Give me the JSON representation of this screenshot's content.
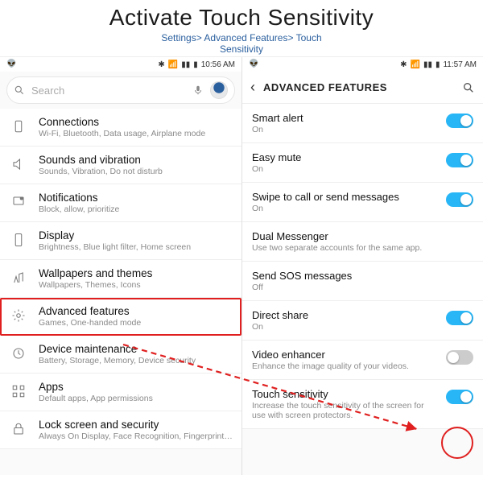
{
  "header": {
    "title": "Activate Touch Sensitivity",
    "breadcrumb1": "Settings> Advanced Features> Touch",
    "breadcrumb2": "Sensitivity"
  },
  "left": {
    "status": {
      "left_icon": "reddit-icon",
      "time": "10:56 AM"
    },
    "search": {
      "placeholder": "Search"
    },
    "items": [
      {
        "icon": "connections-icon",
        "label": "Connections",
        "sub": "Wi-Fi, Bluetooth, Data usage, Airplane mode"
      },
      {
        "icon": "sound-icon",
        "label": "Sounds and vibration",
        "sub": "Sounds, Vibration, Do not disturb"
      },
      {
        "icon": "notifications-icon",
        "label": "Notifications",
        "sub": "Block, allow, prioritize"
      },
      {
        "icon": "display-icon",
        "label": "Display",
        "sub": "Brightness, Blue light filter, Home screen"
      },
      {
        "icon": "wallpaper-icon",
        "label": "Wallpapers and themes",
        "sub": "Wallpapers, Themes, Icons"
      },
      {
        "icon": "advanced-icon",
        "label": "Advanced features",
        "sub": "Games, One-handed mode",
        "highlight": true
      },
      {
        "icon": "maintenance-icon",
        "label": "Device maintenance",
        "sub": "Battery, Storage, Memory, Device security"
      },
      {
        "icon": "apps-icon",
        "label": "Apps",
        "sub": "Default apps, App permissions"
      },
      {
        "icon": "lock-icon",
        "label": "Lock screen and security",
        "sub": "Always On Display, Face Recognition, Fingerprints, Iris"
      }
    ]
  },
  "right": {
    "status": {
      "left_icon": "reddit-icon",
      "time": "11:57 AM"
    },
    "header": {
      "title": "ADVANCED FEATURES"
    },
    "items": [
      {
        "label": "Smart alert",
        "sub": "On",
        "toggle": "on"
      },
      {
        "label": "Easy mute",
        "sub": "On",
        "toggle": "on"
      },
      {
        "label": "Swipe to call or send messages",
        "sub": "On",
        "toggle": "on"
      },
      {
        "label": "Dual Messenger",
        "sub": "Use two separate accounts for the same app."
      },
      {
        "label": "Send SOS messages",
        "sub": "Off"
      },
      {
        "label": "Direct share",
        "sub": "On",
        "toggle": "on"
      },
      {
        "label": "Video enhancer",
        "sub": "Enhance the image quality of your videos.",
        "toggle": "off"
      },
      {
        "label": "Touch sensitivity",
        "sub": "Increase the touch sensitivity of the screen for use with screen protectors.",
        "toggle": "on",
        "ring": true
      }
    ]
  }
}
